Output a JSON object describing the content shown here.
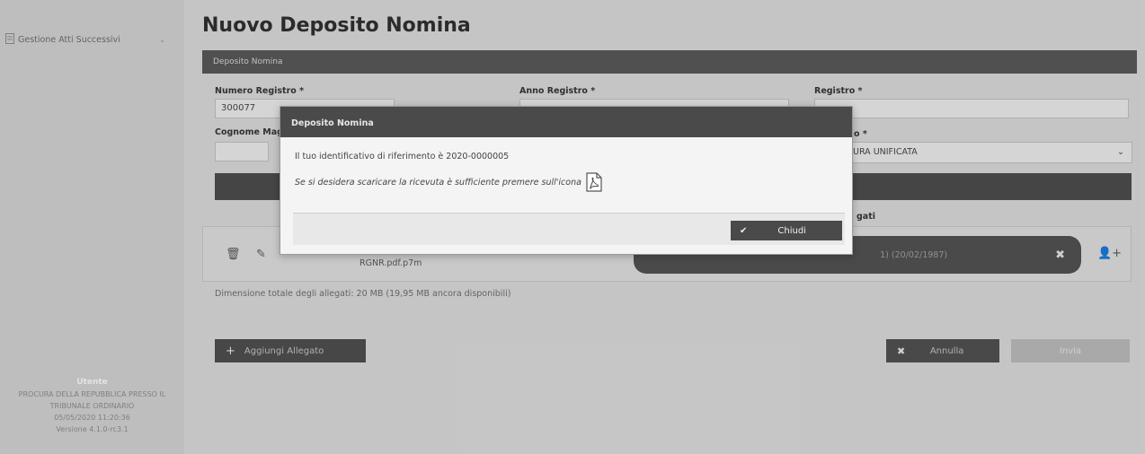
{
  "sidebar": {
    "menu_item": "Gestione Atti Successivi",
    "footer": {
      "user": "Utente",
      "org_line1": "PROCURA DELLA REPUBBLICA PRESSO IL",
      "org_line2": "TRIBUNALE ORDINARIO",
      "datetime": "05/05/2020 11:20:36",
      "version": "Versione 4.1.0-rc3.1"
    }
  },
  "main": {
    "title": "Nuovo Deposito Nomina",
    "section_title": "Deposito Nomina",
    "fields": {
      "numero_registro_label": "Numero Registro *",
      "numero_registro_value": "300077",
      "anno_registro_label": "Anno Registro *",
      "registro_label": "Registro *",
      "cognome_label": "Cognome Mag",
      "select_label": "o *",
      "select_value": "URA UNIFICATA"
    },
    "allegati_header": "gati",
    "file_name": "RGNR.pdf.p7m",
    "pill_text": "1) (20/02/1987)",
    "dim_text": "Dimensione totale degli allegati: 20 MB (19,95 MB ancora disponibili)",
    "buttons": {
      "add": "Aggiungi Allegato",
      "cancel": "Annulla",
      "send": "Invia"
    }
  },
  "modal": {
    "title": "Deposito Nomina",
    "message": "Il tuo identificativo di riferimento è 2020-0000005",
    "hint": "Se si desidera scaricare la ricevuta è sufficiente premere sull'icona",
    "close_label": "Chiudi"
  }
}
